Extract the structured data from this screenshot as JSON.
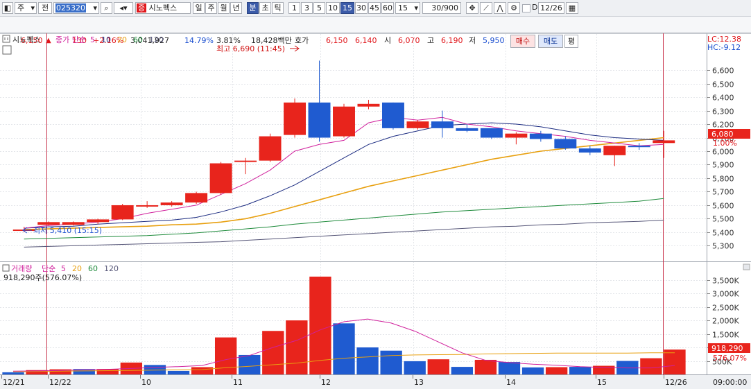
{
  "toolbar": {
    "market": "주",
    "prev": "전",
    "code": "025320",
    "name_badge": "증",
    "name": "시노펙스",
    "periods": [
      "일",
      "주",
      "월",
      "년",
      "분",
      "초",
      "틱"
    ],
    "active_period": "분",
    "intervals": [
      "1",
      "3",
      "5",
      "10",
      "15",
      "30",
      "45",
      "60"
    ],
    "active_interval": "15",
    "interval_select": "15",
    "count": "30/900",
    "checkbox_label": "D",
    "date": "12/26"
  },
  "quote": {
    "price": "6,150",
    "arrow": "▲",
    "change": "130",
    "change_pct": "+2.16%",
    "volume": "3,041,927",
    "vol_ratio": "14.79%",
    "rate2": "3.81%",
    "amount": "18,428백만",
    "hoga_label": "호가",
    "ask": "6,150",
    "bid": "6,140",
    "open_label": "시",
    "open": "6,070",
    "high_label": "고",
    "high": "6,190",
    "low_label": "저",
    "low": "5,950",
    "buy_button": "매수",
    "sell_button": "매도",
    "eval_button": "평"
  },
  "price_panel": {
    "stock_tab": "시노펙스",
    "ma_label": "종가 단순",
    "ma_periods": [
      "5",
      "10",
      "20",
      "60",
      "120"
    ],
    "lc_label": "LC:12.38",
    "hc_label": "HC:-9.12",
    "high_note": "최고 6,690 (11:45)",
    "low_note": "최저 5,410 (15:15)",
    "current_price_tag": "6,080",
    "current_pct_tag": "1.00%"
  },
  "volume_panel": {
    "label": "거래량",
    "ma_label": "단순",
    "ma_periods": [
      "5",
      "20",
      "60",
      "120"
    ],
    "summary": "918,290주(576.07%)",
    "current_vol_tag": "918,290",
    "current_pct_tag": "576.07%"
  },
  "time_axis": [
    "12/21",
    "12/22",
    "10",
    "11",
    "12",
    "13",
    "14",
    "15",
    "12/26"
  ],
  "time_readout": "09:00:00",
  "colors": {
    "up": "#e8241c",
    "down": "#1f5bd0",
    "ma5": "#d0209c",
    "ma10": "#1a2a80",
    "ma20": "#e8a010",
    "ma60": "#1d8a3a",
    "ma120": "#555577"
  },
  "chart_data": {
    "type": "candlestick",
    "price_axis": {
      "ticks": [
        6600,
        6500,
        6400,
        6300,
        6200,
        6100,
        6000,
        5900,
        5800,
        5700,
        5600,
        5500,
        5400,
        5300
      ],
      "ylim": [
        5220,
        6780
      ]
    },
    "candles": [
      {
        "o": 5420,
        "h": 5440,
        "l": 5400,
        "c": 5420
      },
      {
        "o": 5455,
        "h": 5480,
        "l": 5450,
        "c": 5475
      },
      {
        "o": 5455,
        "h": 5480,
        "l": 5450,
        "c": 5475
      },
      {
        "o": 5475,
        "h": 5500,
        "l": 5460,
        "c": 5495
      },
      {
        "o": 5495,
        "h": 5610,
        "l": 5490,
        "c": 5600
      },
      {
        "o": 5590,
        "h": 5630,
        "l": 5580,
        "c": 5600
      },
      {
        "o": 5600,
        "h": 5630,
        "l": 5590,
        "c": 5620
      },
      {
        "o": 5620,
        "h": 5700,
        "l": 5610,
        "c": 5690
      },
      {
        "o": 5690,
        "h": 5920,
        "l": 5680,
        "c": 5910
      },
      {
        "o": 5920,
        "h": 5950,
        "l": 5830,
        "c": 5930
      },
      {
        "o": 5930,
        "h": 6130,
        "l": 5920,
        "c": 6110
      },
      {
        "o": 6120,
        "h": 6390,
        "l": 6100,
        "c": 6360
      },
      {
        "o": 6360,
        "h": 6670,
        "l": 6070,
        "c": 6100
      },
      {
        "o": 6110,
        "h": 6350,
        "l": 6100,
        "c": 6330
      },
      {
        "o": 6330,
        "h": 6380,
        "l": 6310,
        "c": 6350
      },
      {
        "o": 6360,
        "h": 6360,
        "l": 6160,
        "c": 6170
      },
      {
        "o": 6170,
        "h": 6230,
        "l": 6160,
        "c": 6220
      },
      {
        "o": 6220,
        "h": 6300,
        "l": 6100,
        "c": 6170
      },
      {
        "o": 6170,
        "h": 6200,
        "l": 6140,
        "c": 6150
      },
      {
        "o": 6170,
        "h": 6170,
        "l": 6090,
        "c": 6100
      },
      {
        "o": 6100,
        "h": 6140,
        "l": 6050,
        "c": 6130
      },
      {
        "o": 6130,
        "h": 6150,
        "l": 6070,
        "c": 6090
      },
      {
        "o": 6090,
        "h": 6110,
        "l": 6010,
        "c": 6020
      },
      {
        "o": 6020,
        "h": 6040,
        "l": 5970,
        "c": 5990
      },
      {
        "o": 5970,
        "h": 6040,
        "l": 5890,
        "c": 6040
      },
      {
        "o": 6040,
        "h": 6060,
        "l": 6010,
        "c": 6030
      },
      {
        "o": 6060,
        "h": 6150,
        "l": 5950,
        "c": 6080
      }
    ],
    "ma": {
      "ma5": [
        5430,
        5450,
        5460,
        5475,
        5500,
        5540,
        5570,
        5600,
        5680,
        5760,
        5860,
        6000,
        6050,
        6080,
        6210,
        6250,
        6230,
        6250,
        6200,
        6180,
        6150,
        6130,
        6110,
        6080,
        6060,
        6040,
        6050
      ],
      "ma10": [
        5430,
        5440,
        5445,
        5460,
        5470,
        5480,
        5490,
        5510,
        5550,
        5600,
        5670,
        5750,
        5850,
        5950,
        6050,
        6110,
        6150,
        6190,
        6200,
        6210,
        6200,
        6180,
        6150,
        6120,
        6100,
        6090,
        6080
      ],
      "ma20": [
        5420,
        5425,
        5430,
        5435,
        5440,
        5445,
        5455,
        5460,
        5475,
        5500,
        5540,
        5590,
        5640,
        5690,
        5740,
        5780,
        5820,
        5860,
        5900,
        5940,
        5970,
        6000,
        6020,
        6040,
        6060,
        6080,
        6100
      ],
      "ma60": [
        5350,
        5355,
        5360,
        5365,
        5370,
        5375,
        5385,
        5395,
        5410,
        5425,
        5440,
        5460,
        5475,
        5490,
        5505,
        5520,
        5535,
        5550,
        5560,
        5570,
        5580,
        5590,
        5600,
        5610,
        5620,
        5630,
        5650
      ],
      "ma120": [
        5290,
        5295,
        5300,
        5305,
        5310,
        5315,
        5320,
        5325,
        5330,
        5340,
        5350,
        5360,
        5370,
        5380,
        5390,
        5400,
        5410,
        5420,
        5430,
        5440,
        5445,
        5455,
        5460,
        5470,
        5475,
        5480,
        5490
      ]
    },
    "volume_axis": {
      "ticks": [
        3500,
        3000,
        2500,
        2000,
        1500,
        1000,
        500
      ],
      "tick_labels": [
        "3,500K",
        "3,000K",
        "2,500K",
        "2,000K",
        "1,500K",
        "1,000K",
        "500K"
      ],
      "ylim": [
        0,
        3900
      ]
    },
    "volume": [
      80,
      160,
      190,
      200,
      200,
      440,
      350,
      130,
      270,
      1370,
      720,
      1610,
      2000,
      3620,
      1890,
      1000,
      880,
      490,
      560,
      280,
      540,
      460,
      260,
      270,
      280,
      320,
      500,
      600,
      920
    ],
    "volume_up": [
      false,
      true,
      true,
      false,
      true,
      true,
      false,
      false,
      true,
      true,
      false,
      true,
      true,
      true,
      false,
      false,
      false,
      false,
      true,
      false,
      true,
      false,
      false,
      true,
      false,
      true,
      false,
      true,
      true
    ],
    "volume_ma5": [
      120,
      130,
      150,
      170,
      190,
      220,
      260,
      290,
      330,
      550,
      700,
      1000,
      1260,
      1650,
      1950,
      2050,
      1900,
      1600,
      1200,
      800,
      520,
      440,
      380,
      340,
      290,
      260,
      240,
      240,
      330
    ],
    "volume_ma20": [
      100,
      110,
      120,
      130,
      140,
      150,
      160,
      170,
      180,
      250,
      300,
      360,
      420,
      520,
      600,
      650,
      700,
      720,
      730,
      740,
      760,
      770,
      780,
      790,
      790,
      790,
      790,
      800,
      800
    ]
  }
}
